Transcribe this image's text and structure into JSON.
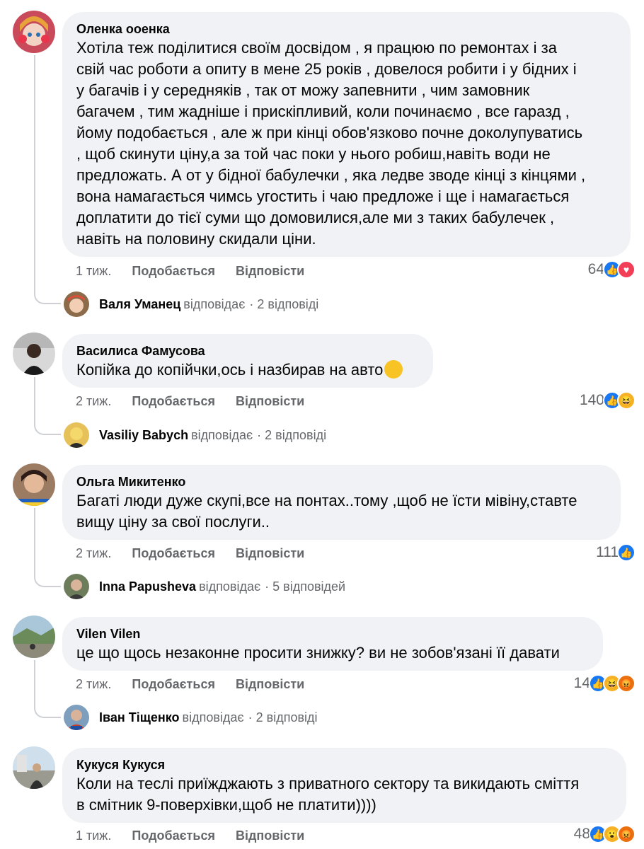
{
  "comments": [
    {
      "author": "Оленка ооенка",
      "text": "Хотіла теж поділитися своїм досвідом , я працюю по ремонтах і за\nсвій час роботи а опиту в мене 25 років , довелося робити і у бідних і\nу багачів і у середняків , так от можу запевнити , чим замовник\nбагачем , тим жадніше і прискіпливий, коли починаємо , все гаразд ,\nйому подобається , але ж при кінці обов'язково почне доколупуватись\n, щоб скинути ціну,а за той час поки у нього робиш,навіть води не\nпредложать. А от у бідної бабулечки , яка ледве зводе кінці з кінцями ,\nвона намагається чимсь угостить і чаю предложе і ще і намагається\nдоплатити до тієї суми що домовилися,але ми з таких бабулечек ,\nнавіть на половину скидали ціни.",
      "time": "1 тиж.",
      "like_label": "Подобається",
      "reply_label": "Відповісти",
      "reaction_count": "64",
      "reactions": [
        "like-icon",
        "love-icon"
      ],
      "reply": {
        "name": "Валя Уманец",
        "verb": "відповідає",
        "count": "· 2 відповіді"
      }
    },
    {
      "author": "Василиса Фамусова",
      "text": "Копійка до копійчки,ось і назбирав на авто",
      "time": "2 тиж.",
      "like_label": "Подобається",
      "reply_label": "Відповісти",
      "reaction_count": "140",
      "reactions": [
        "like-icon",
        "haha-icon"
      ],
      "reply": {
        "name": "Vasiliy Babych",
        "verb": "відповідає",
        "count": "· 2 відповіді"
      }
    },
    {
      "author": "Ольга Микитенко",
      "text": "Багаті люди дуже скупі,все на понтах..тому ,щоб не їсти мівіну,ставте\nвищу ціну за свої послуги..",
      "time": "2 тиж.",
      "like_label": "Подобається",
      "reply_label": "Відповісти",
      "reaction_count": "111",
      "reactions": [
        "like-icon"
      ],
      "reply": {
        "name": "Inna Papusheva",
        "verb": "відповідає",
        "count": "· 5 відповідей"
      }
    },
    {
      "author": "Vilen Vilen",
      "text": "це що щось незаконне просити знижку? ви не зобов'язані її давати",
      "time": "2 тиж.",
      "like_label": "Подобається",
      "reply_label": "Відповісти",
      "reaction_count": "14",
      "reactions": [
        "like-icon",
        "haha-icon",
        "angry-icon"
      ],
      "reply": {
        "name": "Іван Тіщенко",
        "verb": "відповідає",
        "count": "· 2 відповіді"
      }
    },
    {
      "author": "Кукуся Кукуся",
      "text": "Коли на теслі приїжджають з приватного сектору та викидають сміття\nв смітник 9-поверхівки,щоб не платити))))",
      "time": "1 тиж.",
      "like_label": "Подобається",
      "reply_label": "Відповісти",
      "reaction_count": "48",
      "reactions": [
        "like-icon",
        "wow-icon",
        "angry-icon"
      ]
    }
  ],
  "colors": {
    "bubble": "#f0f2f5",
    "meta": "#65676b",
    "like": "#1877f2",
    "love": "#f33e58",
    "haha": "#f7b125",
    "angry": "#e9710f"
  }
}
